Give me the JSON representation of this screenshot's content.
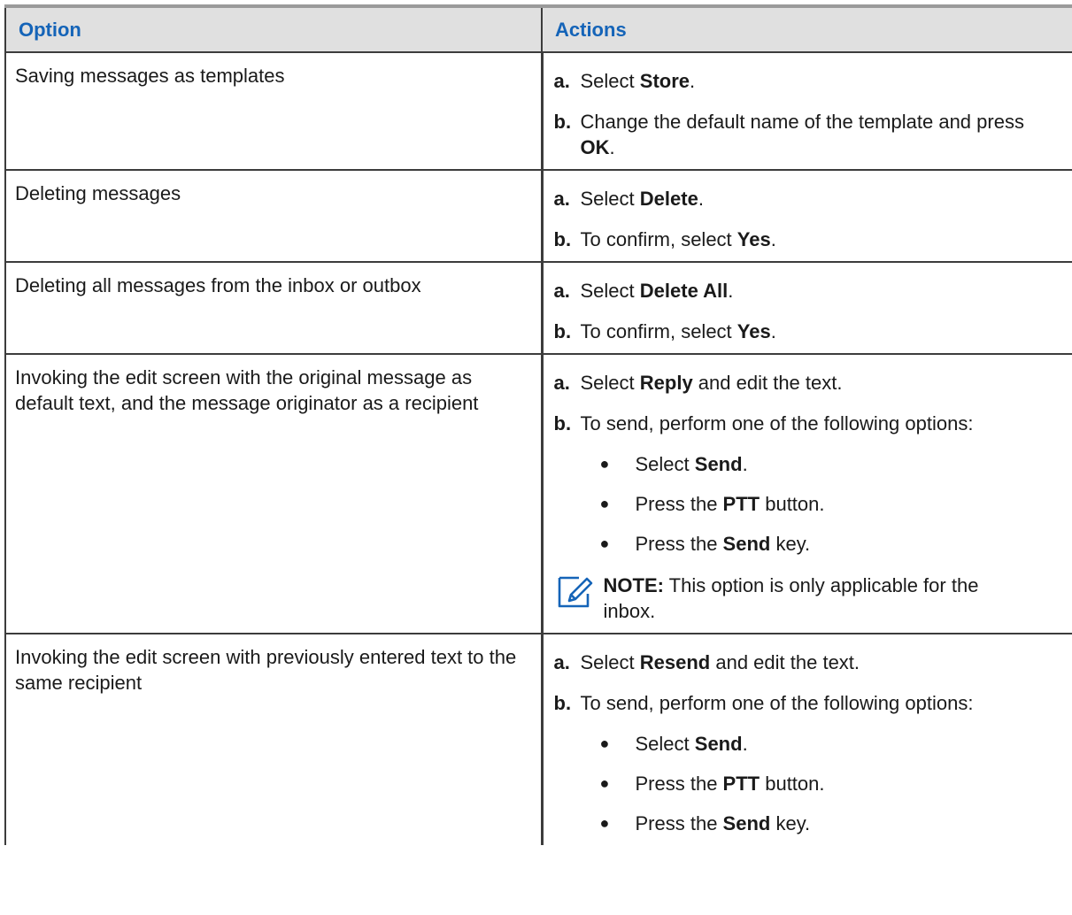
{
  "table": {
    "headers": {
      "option": "Option",
      "actions": "Actions"
    },
    "note": {
      "label": "NOTE:",
      "text": "This option is only applicable for the inbox."
    },
    "rows": [
      {
        "option": "Saving messages as templates",
        "steps": [
          {
            "letter": "a.",
            "before": "Select ",
            "bold": "Store",
            "after": "."
          },
          {
            "letter": "b.",
            "before": "Change the default name of the template and press ",
            "bold": "OK",
            "after": "."
          }
        ]
      },
      {
        "option": "Deleting messages",
        "steps": [
          {
            "letter": "a.",
            "before": "Select ",
            "bold": "Delete",
            "after": "."
          },
          {
            "letter": "b.",
            "before": "To confirm, select ",
            "bold": "Yes",
            "after": "."
          }
        ]
      },
      {
        "option": "Deleting all messages from the inbox or outbox",
        "steps": [
          {
            "letter": "a.",
            "before": "Select ",
            "bold": "Delete All",
            "after": "."
          },
          {
            "letter": "b.",
            "before": "To confirm, select ",
            "bold": "Yes",
            "after": "."
          }
        ]
      },
      {
        "option": "Invoking the edit screen with the original mes­sage as default text, and the message origina­tor as a recipient",
        "steps": [
          {
            "letter": "a.",
            "before": "Select ",
            "bold": "Reply",
            "after": " and edit the text."
          },
          {
            "letter": "b.",
            "before": "To send, perform one of the following op­tions:",
            "bold": "",
            "after": ""
          }
        ],
        "bullets": [
          {
            "before": "Select ",
            "bold": "Send",
            "after": "."
          },
          {
            "before": "Press the ",
            "bold": "PTT",
            "after": " button."
          },
          {
            "before": "Press the ",
            "bold": "Send",
            "after": " key."
          }
        ]
      },
      {
        "option": "Invoking the edit screen with previously en­tered text to the same recipient",
        "steps": [
          {
            "letter": "a.",
            "before": "Select ",
            "bold": "Resend",
            "after": " and edit the text."
          },
          {
            "letter": "b.",
            "before": "To send, perform one of the following op­tions:",
            "bold": "",
            "after": ""
          }
        ],
        "bullets": [
          {
            "before": "Select ",
            "bold": "Send",
            "after": "."
          },
          {
            "before": "Press the ",
            "bold": "PTT",
            "after": " button."
          },
          {
            "before": "Press the ",
            "bold": "Send",
            "after": " key."
          }
        ]
      }
    ]
  }
}
